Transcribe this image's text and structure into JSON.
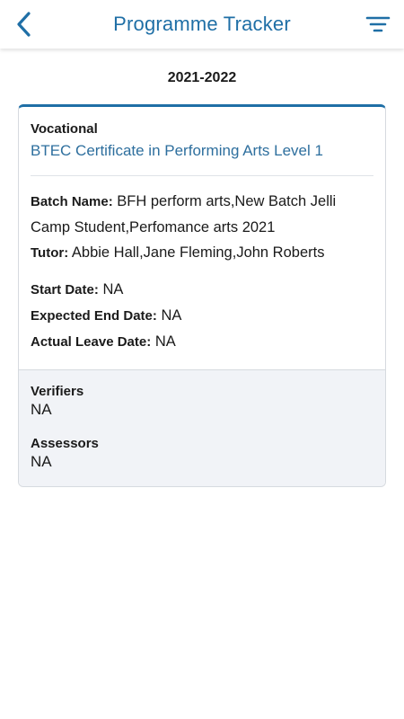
{
  "header": {
    "title": "Programme Tracker",
    "back_icon": "chevron-left-icon",
    "filter_icon": "filter-icon",
    "accent_color": "#1f6fa6"
  },
  "year": "2021-2022",
  "card": {
    "type_label": "Vocational",
    "course_name": "BTEC Certificate in Performing Arts Level 1",
    "batch_key": "Batch Name:",
    "batch_value": "BFH perform arts,New Batch Jelli Camp Student,Perfomance arts 2021",
    "tutor_key": "Tutor:",
    "tutor_value": "Abbie Hall,Jane Fleming,John Roberts",
    "start_key": "Start Date:",
    "start_value": "NA",
    "expected_end_key": "Expected End Date:",
    "expected_end_value": "NA",
    "actual_leave_key": "Actual Leave Date:",
    "actual_leave_value": "NA",
    "verifiers_label": "Verifiers",
    "verifiers_value": "NA",
    "assessors_label": "Assessors",
    "assessors_value": "NA"
  }
}
